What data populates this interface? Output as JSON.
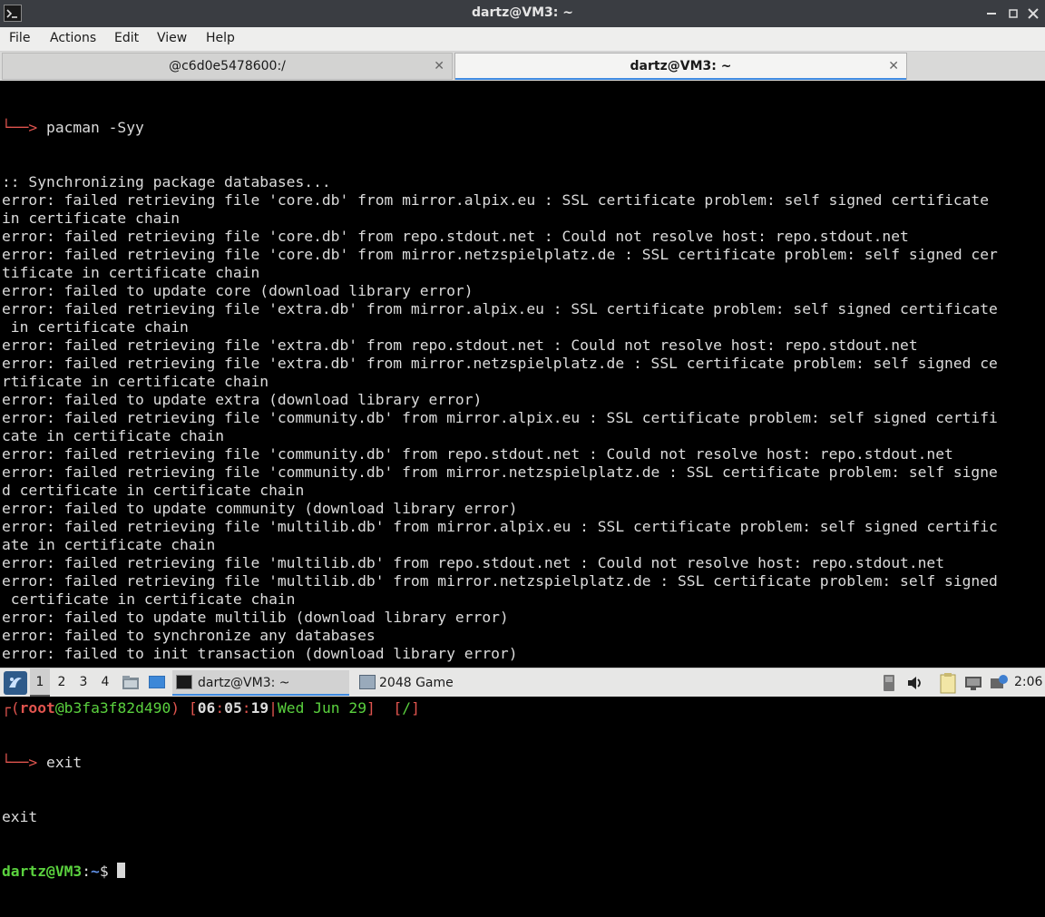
{
  "window": {
    "title": "dartz@VM3: ~"
  },
  "menu": [
    "File",
    "Actions",
    "Edit",
    "View",
    "Help"
  ],
  "tabs": [
    {
      "label": "@c6d0e5478600:/",
      "close": "✕"
    },
    {
      "label": "dartz@VM3: ~",
      "close": "✕"
    }
  ],
  "terminal": {
    "command_arrow": "└──> ",
    "command": "pacman -Syy",
    "output": [
      ":: Synchronizing package databases...",
      "error: failed retrieving file 'core.db' from mirror.alpix.eu : SSL certificate problem: self signed certificate",
      "in certificate chain",
      "error: failed retrieving file 'core.db' from repo.stdout.net : Could not resolve host: repo.stdout.net",
      "error: failed retrieving file 'core.db' from mirror.netzspielplatz.de : SSL certificate problem: self signed cer",
      "tificate in certificate chain",
      "error: failed to update core (download library error)",
      "error: failed retrieving file 'extra.db' from mirror.alpix.eu : SSL certificate problem: self signed certificate",
      " in certificate chain",
      "error: failed retrieving file 'extra.db' from repo.stdout.net : Could not resolve host: repo.stdout.net",
      "error: failed retrieving file 'extra.db' from mirror.netzspielplatz.de : SSL certificate problem: self signed ce",
      "rtificate in certificate chain",
      "error: failed to update extra (download library error)",
      "error: failed retrieving file 'community.db' from mirror.alpix.eu : SSL certificate problem: self signed certifi",
      "cate in certificate chain",
      "error: failed retrieving file 'community.db' from repo.stdout.net : Could not resolve host: repo.stdout.net",
      "error: failed retrieving file 'community.db' from mirror.netzspielplatz.de : SSL certificate problem: self signe",
      "d certificate in certificate chain",
      "error: failed to update community (download library error)",
      "error: failed retrieving file 'multilib.db' from mirror.alpix.eu : SSL certificate problem: self signed certific",
      "ate in certificate chain",
      "error: failed retrieving file 'multilib.db' from repo.stdout.net : Could not resolve host: repo.stdout.net",
      "error: failed retrieving file 'multilib.db' from mirror.netzspielplatz.de : SSL certificate problem: self signed",
      " certificate in certificate chain",
      "error: failed to update multilib (download library error)",
      "error: failed to synchronize any databases",
      "error: failed to init transaction (download library error)"
    ],
    "prompt": {
      "corner": "┌",
      "open_paren": "(",
      "user": "root",
      "at": "@",
      "host": "b3fa3f82d490",
      "close_paren": ")",
      "open_bracket": " [",
      "hour": "06",
      "colon1": ":",
      "minute": "05",
      "colon2": ":",
      "second": "19",
      "pipe": "|",
      "date": "Wed Jun 29",
      "close_bracket": "]",
      "dir_open": "  [",
      "dir": "/",
      "dir_close": "]"
    },
    "exit_arrow": "└──> ",
    "exit_command": "exit",
    "exit_output": "exit",
    "shell_user_host": "dartz@VM3",
    "shell_colon": ":",
    "shell_path": "~",
    "shell_dollar": "$ "
  },
  "taskbar": {
    "desktops": [
      "1",
      "2",
      "3",
      "4"
    ],
    "tasks": [
      {
        "label": "dartz@VM3: ~"
      },
      {
        "label": "2048 Game"
      }
    ],
    "clock": "2:06"
  }
}
